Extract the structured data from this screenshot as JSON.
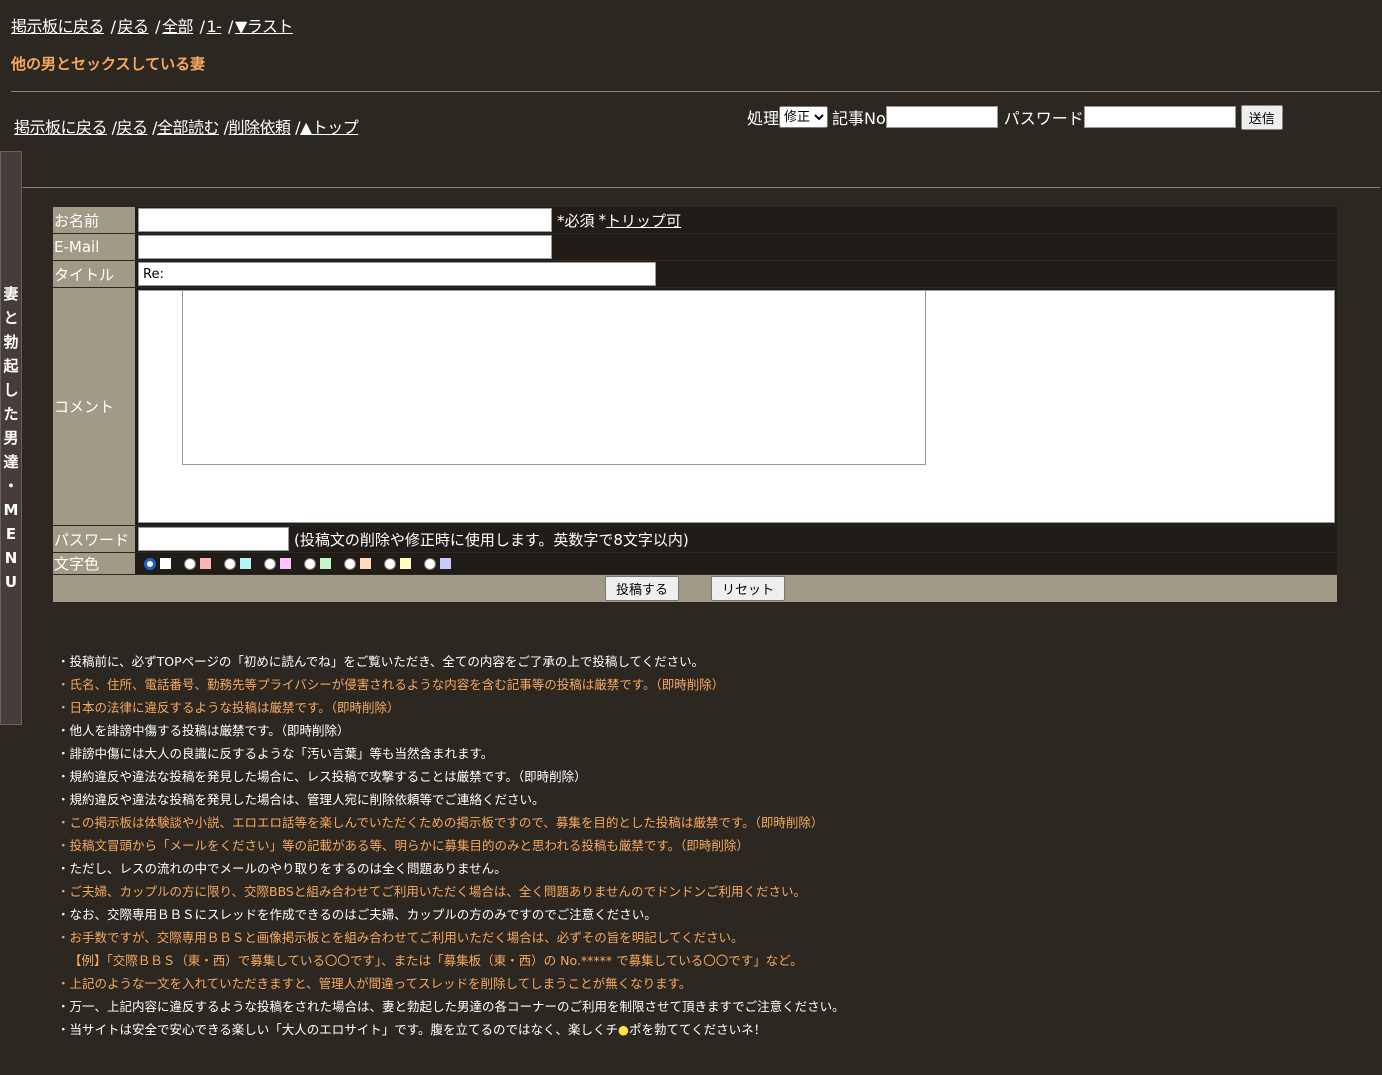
{
  "topnav": {
    "links": [
      "掲示板に戻る",
      "戻る",
      "全部",
      "1-",
      "▼ラスト"
    ],
    "separator": "/"
  },
  "thread_title": "他の男とセックスしている妻",
  "nav2": {
    "links": [
      "掲示板に戻る",
      "戻る",
      "全部読む",
      "削除依頼",
      "▲トップ"
    ],
    "separator": "/"
  },
  "process_form": {
    "label": "処理",
    "select_value": "修正",
    "article_no_label": "記事No",
    "password_label": "パスワード",
    "submit_label": "送信"
  },
  "side_menu": {
    "chars": [
      "妻",
      "と",
      "勃",
      "起",
      "し",
      "た",
      "男",
      "達",
      "・",
      "M",
      "E",
      "N",
      "U"
    ]
  },
  "post_form": {
    "name_label": "お名前",
    "name_note_required": "*必須",
    "name_note_star": "*",
    "name_note_trip": "トリップ可",
    "email_label": "E-Mail",
    "title_label": "タイトル",
    "title_value": "Re:",
    "comment_label": "コメント",
    "password_label": "パスワード",
    "password_note": "(投稿文の削除や修正時に使用します。英数字で8文字以内)",
    "color_label": "文字色",
    "colors": [
      "#ffffff",
      "#ffb3b3",
      "#b3f5f5",
      "#ffc1ff",
      "#c4f5c4",
      "#ffd9b8",
      "#ffffc0",
      "#c8c8ff"
    ],
    "submit_label": "投稿する",
    "reset_label": "リセット"
  },
  "rules": [
    {
      "c": "w",
      "t": "・投稿前に、必ずTOPページの「初めに読んでね」をご覧いただき、全ての内容をご了承の上で投稿してください。"
    },
    {
      "c": "o",
      "t": "・氏名、住所、電話番号、勤務先等プライバシーが侵害されるような内容を含む記事等の投稿は厳禁です。（即時削除）"
    },
    {
      "c": "o",
      "t": "・日本の法律に違反するような投稿は厳禁です。（即時削除）"
    },
    {
      "c": "w",
      "t": "・他人を誹謗中傷する投稿は厳禁です。（即時削除）"
    },
    {
      "c": "w",
      "t": "・誹謗中傷には大人の良識に反するような「汚い言葉」等も当然含まれます。"
    },
    {
      "c": "w",
      "t": "・規約違反や違法な投稿を発見した場合に、レス投稿で攻撃することは厳禁です。（即時削除）"
    },
    {
      "c": "w",
      "t": "・規約違反や違法な投稿を発見した場合は、管理人宛に削除依頼等でご連絡ください。"
    },
    {
      "c": "o",
      "t": "・この掲示板は体験談や小説、エロエロ話等を楽しんでいただくための掲示板ですので、募集を目的とした投稿は厳禁です。（即時削除）"
    },
    {
      "c": "o",
      "t": "・投稿文冒頭から「メールをください」等の記載がある等、明らかに募集目的のみと思われる投稿も厳禁です。（即時削除）"
    },
    {
      "c": "w",
      "t": "・ただし、レスの流れの中でメールのやり取りをするのは全く問題ありません。"
    },
    {
      "c": "o",
      "t": "・ご夫婦、カップルの方に限り、交際BBSと組み合わせてご利用いただく場合は、全く問題ありませんのでドンドンご利用ください。"
    },
    {
      "c": "w",
      "t": "・なお、交際専用ＢＢＳにスレッドを作成できるのはご夫婦、カップルの方のみですのでご注意ください。"
    },
    {
      "c": "o",
      "t": "・お手数ですが、交際専用ＢＢＳと画像掲示板とを組み合わせてご利用いただく場合は、必ずその旨を明記してください。"
    },
    {
      "c": "o ex",
      "t": "【例】「交際ＢＢＳ（東・西）で募集している〇〇です」、または「募集板（東・西）の No.***** で募集している〇〇です」など。"
    },
    {
      "c": "o",
      "t": "・上記のような一文を入れていただきますと、管理人が間違ってスレッドを削除してしまうことが無くなります。"
    },
    {
      "c": "w",
      "t": "・万一、上記内容に違反するような投稿をされた場合は、妻と勃起した男達の各コーナーのご利用を制限させて頂きますでご注意ください。"
    }
  ],
  "last_rule": {
    "before": "・当サイトは安全で安心できる楽しい「大人のエロサイト」です。腹を立てるのではなく、楽しくチ",
    "mark": "●",
    "after": "ポを勃ててくださいネ！"
  }
}
